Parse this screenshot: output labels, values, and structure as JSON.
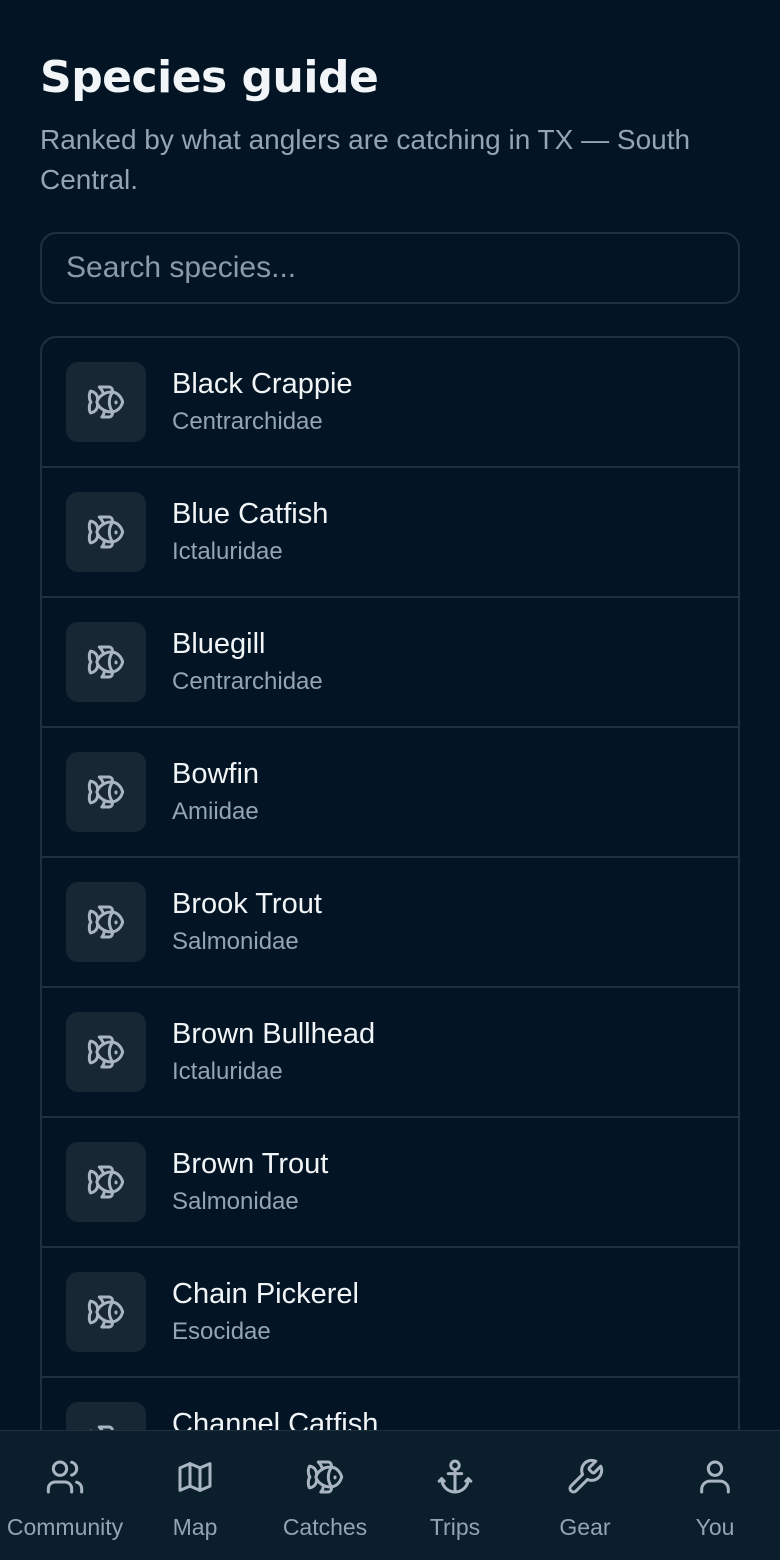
{
  "page": {
    "title": "Species guide",
    "subtitle": "Ranked by what anglers are catching in TX — South Central."
  },
  "search": {
    "placeholder": "Search species..."
  },
  "species": [
    {
      "name": "Black Crappie",
      "family": "Centrarchidae",
      "icon": "fish-icon"
    },
    {
      "name": "Blue Catfish",
      "family": "Ictaluridae",
      "icon": "fish-icon"
    },
    {
      "name": "Bluegill",
      "family": "Centrarchidae",
      "icon": "fish-icon"
    },
    {
      "name": "Bowfin",
      "family": "Amiidae",
      "icon": "fish-icon"
    },
    {
      "name": "Brook Trout",
      "family": "Salmonidae",
      "icon": "fish-icon"
    },
    {
      "name": "Brown Bullhead",
      "family": "Ictaluridae",
      "icon": "fish-icon"
    },
    {
      "name": "Brown Trout",
      "family": "Salmonidae",
      "icon": "fish-icon"
    },
    {
      "name": "Chain Pickerel",
      "family": "Esocidae",
      "icon": "fish-icon"
    },
    {
      "name": "Channel Catfish",
      "family": "",
      "icon": "fish-icon"
    }
  ],
  "nav": [
    {
      "label": "Community",
      "icon": "people-icon"
    },
    {
      "label": "Map",
      "icon": "map-icon"
    },
    {
      "label": "Catches",
      "icon": "fish-icon"
    },
    {
      "label": "Trips",
      "icon": "anchor-icon"
    },
    {
      "label": "Gear",
      "icon": "wrench-icon"
    },
    {
      "label": "You",
      "icon": "user-icon"
    }
  ],
  "colors": {
    "background": "#031524",
    "card_border": "#1f3140",
    "icon_tile": "#172734",
    "muted_text": "#94a4b2",
    "nav_background": "#0a1e2c"
  }
}
